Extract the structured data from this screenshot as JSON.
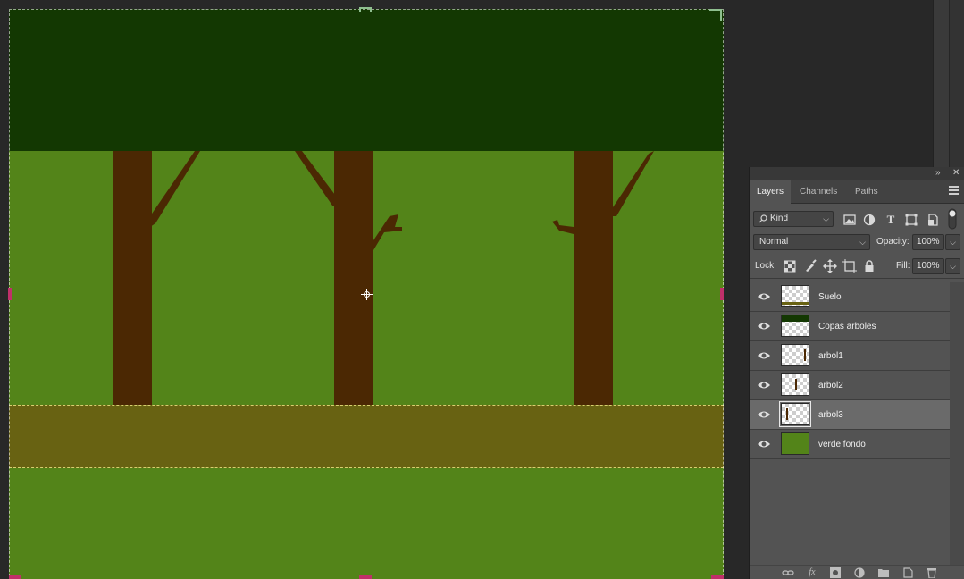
{
  "colors": {
    "canopy": "#133802",
    "grass": "#538419",
    "ground": "#686212",
    "trunk": "#4b2803"
  },
  "panel": {
    "tabs": [
      {
        "label": "Layers",
        "active": true
      },
      {
        "label": "Channels",
        "active": false
      },
      {
        "label": "Paths",
        "active": false
      }
    ],
    "filter": {
      "label": "Kind"
    },
    "blend_mode": "Normal",
    "opacity_label": "Opacity:",
    "opacity_value": "100%",
    "lock_label": "Lock:",
    "fill_label": "Fill:",
    "fill_value": "100%",
    "filter_icons": [
      "image-filter-icon",
      "adjustment-filter-icon",
      "type-filter-icon",
      "shape-filter-icon",
      "smart-object-filter-icon",
      "filter-toggle-icon"
    ],
    "lock_icons": [
      "lock-transparent-pixels-icon",
      "lock-image-pixels-icon",
      "lock-position-icon",
      "lock-artboard-icon",
      "lock-all-icon"
    ],
    "bottom_icons": [
      "link-layers-icon",
      "fx-icon",
      "add-mask-icon",
      "new-adjustment-icon",
      "new-group-icon",
      "new-layer-icon",
      "delete-layer-icon"
    ],
    "layers": [
      {
        "name": "Suelo",
        "visible": true,
        "selected": false
      },
      {
        "name": "Copas arboles",
        "visible": true,
        "selected": false
      },
      {
        "name": "arbol1",
        "visible": true,
        "selected": false
      },
      {
        "name": "arbol2",
        "visible": true,
        "selected": false
      },
      {
        "name": "arbol3",
        "visible": true,
        "selected": true
      },
      {
        "name": "verde fondo",
        "visible": true,
        "selected": false
      }
    ]
  }
}
